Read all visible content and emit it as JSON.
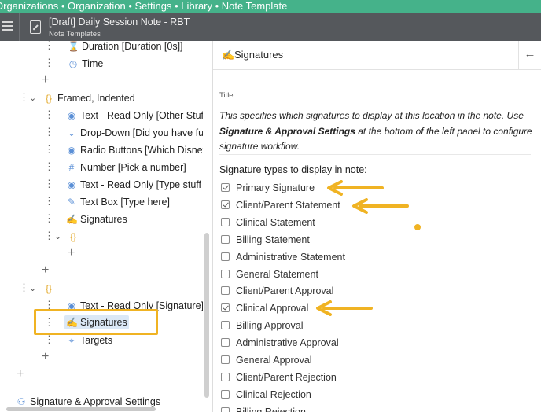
{
  "breadcrumb": [
    "Organizations",
    "Organization",
    "Settings",
    "Library",
    "Note Template"
  ],
  "breadcrumb_sep": " • ",
  "header": {
    "title": "[Draft] Daily Session Note - RBT",
    "subtitle": "Note Templates"
  },
  "tree": {
    "rows": [
      {
        "label": "Duration [Duration [0s]]",
        "icon": "hourglass-icon"
      },
      {
        "label": "Time",
        "icon": "clock-icon"
      },
      {
        "label": "Framed, Indented",
        "icon": "braces-icon"
      },
      {
        "label": "Text - Read Only [Other Stuff",
        "icon": "eye-icon"
      },
      {
        "label": "Drop-Down [Did you have fu",
        "icon": "chevron-down-icon"
      },
      {
        "label": "Radio Buttons [Which Disney",
        "icon": "radio-icon"
      },
      {
        "label": "Number [Pick a number]",
        "icon": "hash-icon"
      },
      {
        "label": "Text - Read Only [Type stuff h",
        "icon": "eye-icon"
      },
      {
        "label": "Text Box [Type here]",
        "icon": "edit-icon"
      },
      {
        "label": "Signatures",
        "icon": "signature-icon"
      },
      {
        "label": "Text - Read Only [Signature]",
        "icon": "eye-icon"
      },
      {
        "label": "Signatures",
        "icon": "signature-icon"
      },
      {
        "label": "Targets",
        "icon": "target-icon"
      }
    ],
    "settings_link": "Signature & Approval Settings"
  },
  "panel": {
    "title": "Signatures",
    "field_label": "Title",
    "desc_part1": "This specifies which signatures to display at this location in the note. Use ",
    "desc_bold": "Signature & Approval Settings",
    "desc_part2": " at the bottom of the left panel to configure signature workflow.",
    "types_label": "Signature types to display in note:",
    "signature_types": [
      {
        "label": "Primary Signature",
        "checked": true
      },
      {
        "label": "Client/Parent Statement",
        "checked": true
      },
      {
        "label": "Clinical Statement",
        "checked": false
      },
      {
        "label": "Billing Statement",
        "checked": false
      },
      {
        "label": "Administrative Statement",
        "checked": false
      },
      {
        "label": "General Statement",
        "checked": false
      },
      {
        "label": "Client/Parent Approval",
        "checked": false
      },
      {
        "label": "Clinical Approval",
        "checked": true
      },
      {
        "label": "Billing Approval",
        "checked": false
      },
      {
        "label": "Administrative Approval",
        "checked": false
      },
      {
        "label": "General Approval",
        "checked": false
      },
      {
        "label": "Client/Parent Rejection",
        "checked": false
      },
      {
        "label": "Clinical Rejection",
        "checked": false
      },
      {
        "label": "Billing Rejection",
        "checked": false
      }
    ]
  },
  "colors": {
    "accent": "#45b28a",
    "header": "#55585c",
    "highlight": "#f0b323",
    "icon": "#5a8fd6"
  }
}
